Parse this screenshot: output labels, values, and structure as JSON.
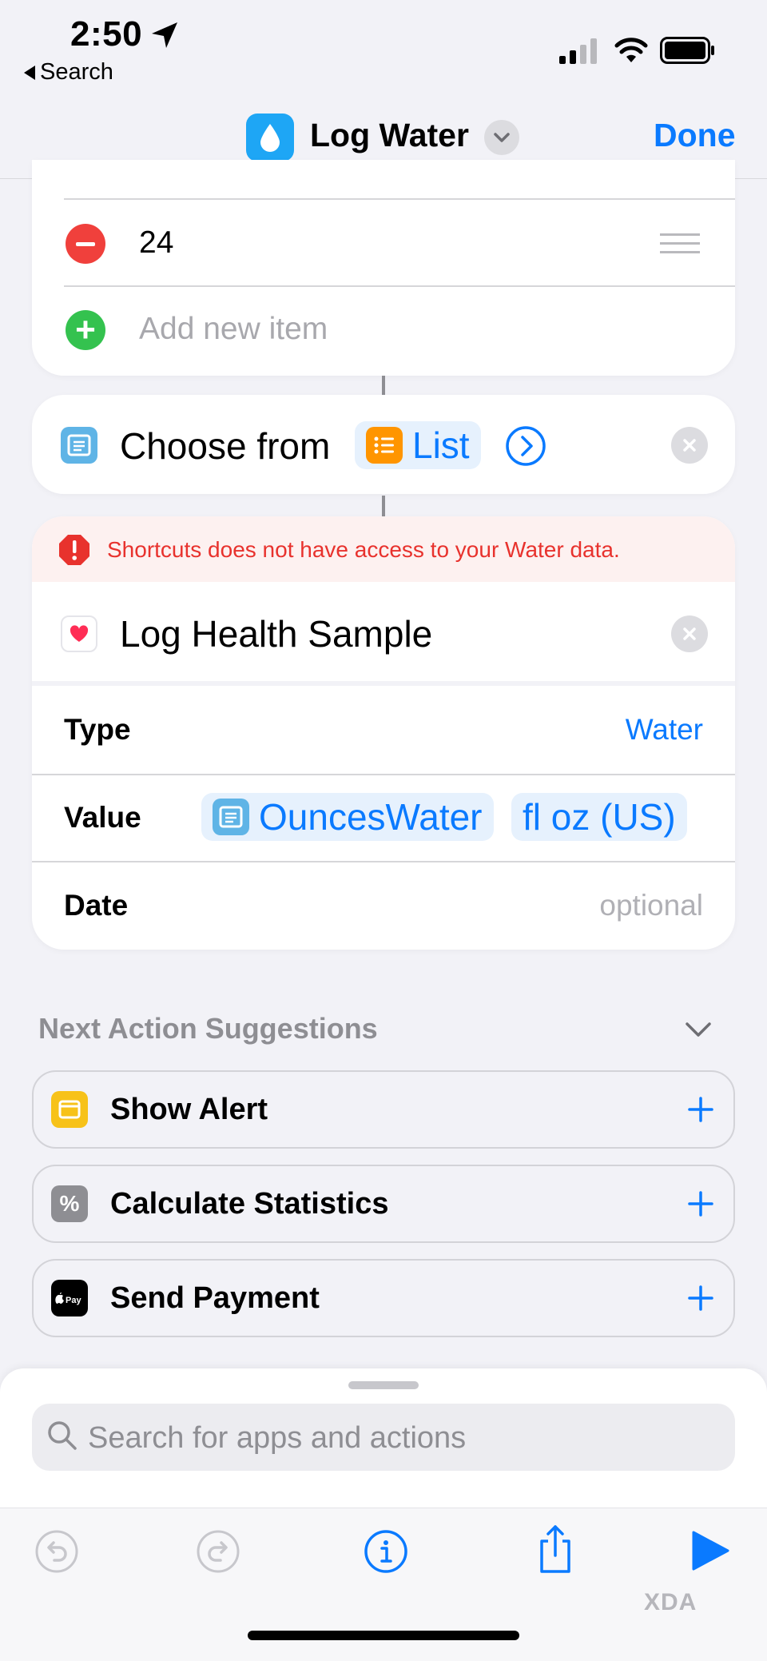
{
  "status_bar": {
    "time": "2:50",
    "back_label": "Search",
    "icons": [
      "location-arrow-icon",
      "signal-bars-icon",
      "wifi-icon",
      "battery-icon"
    ]
  },
  "nav": {
    "title": "Log Water",
    "done_label": "Done",
    "app_icon": "water-drop-icon",
    "accent": "#0a7aff"
  },
  "list_action": {
    "items": [
      {
        "value": "24"
      }
    ],
    "add_placeholder": "Add new item"
  },
  "choose_action": {
    "label": "Choose from",
    "variable": "List"
  },
  "health_action": {
    "warning": "Shortcuts does not have access to your Water data.",
    "title": "Log Health Sample",
    "params": {
      "type_label": "Type",
      "type_value": "Water",
      "value_label": "Value",
      "value_variable": "OuncesWater",
      "value_unit": "fl oz (US)",
      "date_label": "Date",
      "date_placeholder": "optional"
    }
  },
  "suggestions": {
    "header": "Next Action Suggestions",
    "items": [
      {
        "label": "Show Alert",
        "icon": "alert-window-icon",
        "color": "#f7c219"
      },
      {
        "label": "Calculate Statistics",
        "icon": "percent-icon",
        "color": "#8e8e93"
      },
      {
        "label": "Send Payment",
        "icon": "apple-pay-icon",
        "color": "#000000"
      }
    ]
  },
  "search": {
    "placeholder": "Search for apps and actions"
  },
  "watermark": "XDA"
}
